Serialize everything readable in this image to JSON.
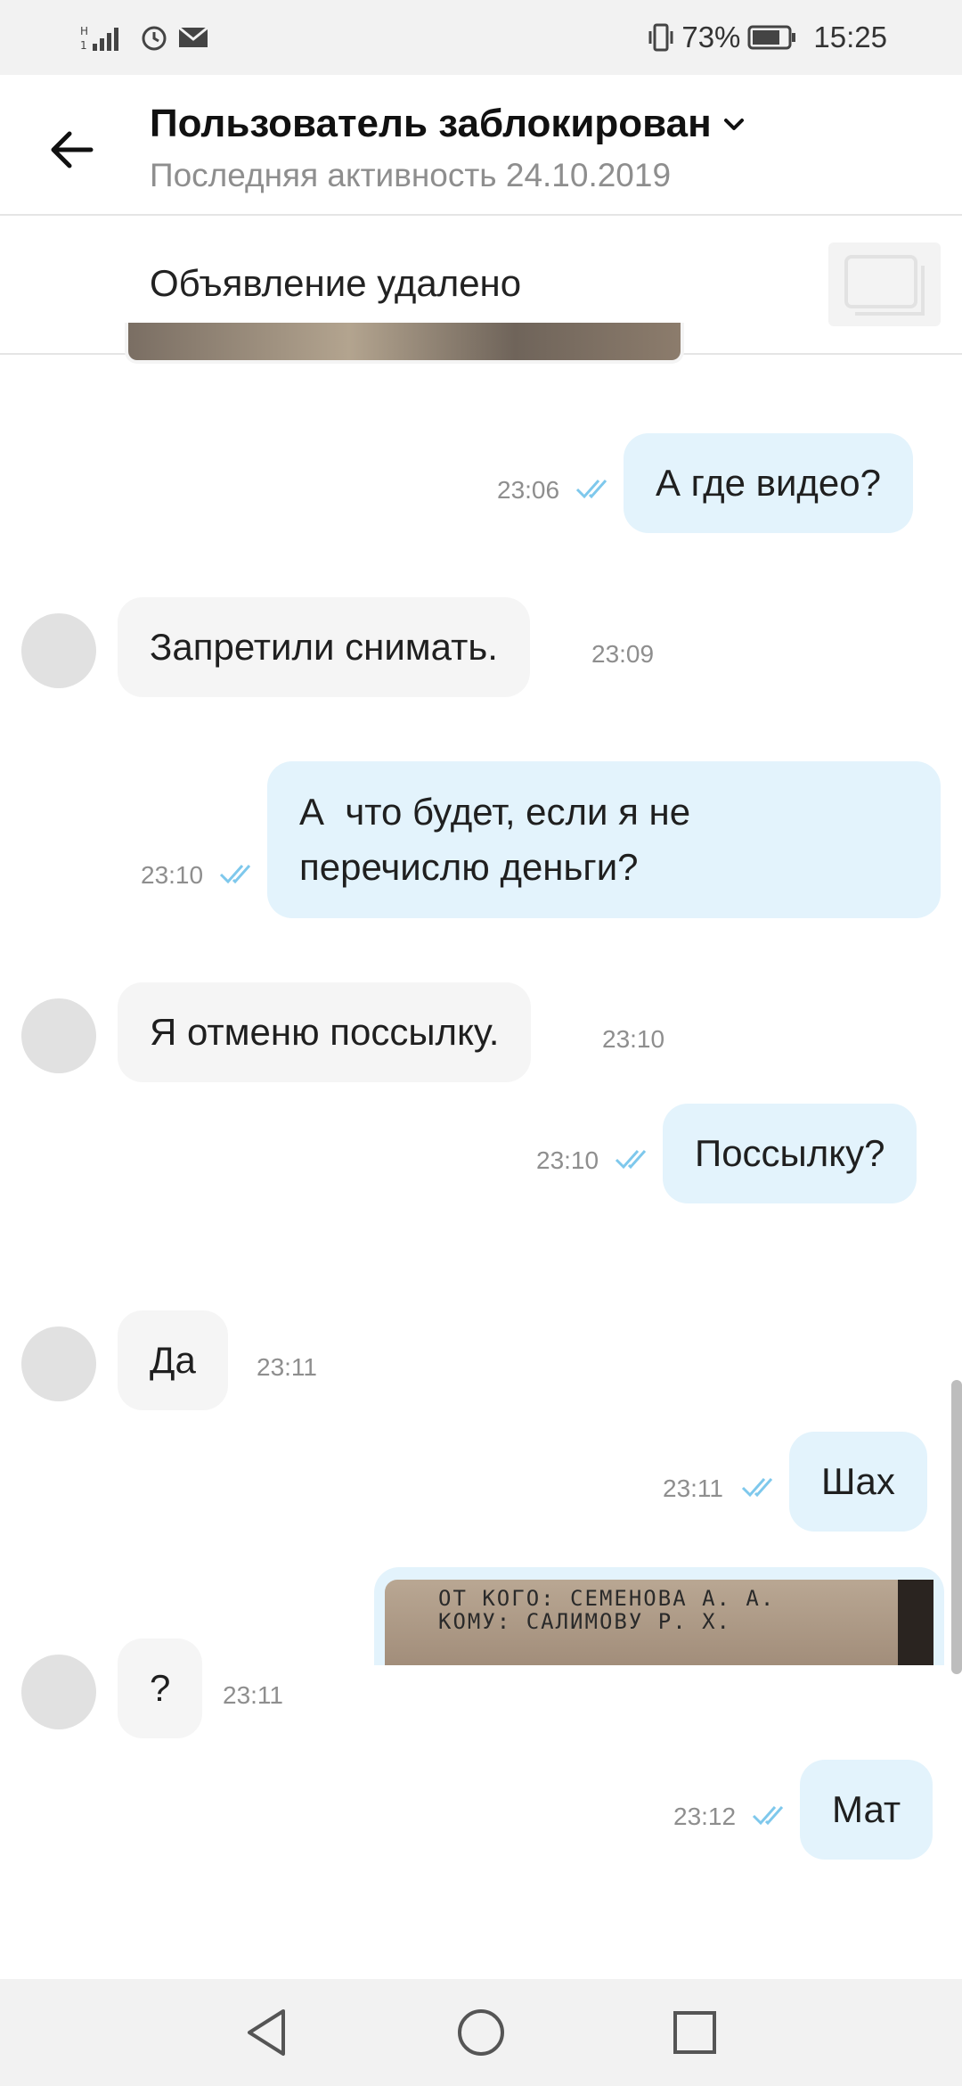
{
  "status_bar": {
    "battery": "73%",
    "time": "15:25",
    "icons": [
      "signal-icon",
      "alarm-icon",
      "mail-icon",
      "vibrate-icon",
      "battery-icon"
    ]
  },
  "header": {
    "title": "Пользователь заблокирован",
    "subtitle": "Последняя активность 24.10.2019"
  },
  "listing": {
    "label": "Объявление удалено"
  },
  "messages": [
    {
      "side": "out",
      "text": "А где видео?",
      "time": "23:06",
      "status": "read"
    },
    {
      "side": "in",
      "text": "Запретили снимать.",
      "time": "23:09"
    },
    {
      "side": "out",
      "text_line1": "А  что будет, если я не",
      "text_line2": "перечислю деньги?",
      "time": "23:10",
      "status": "read"
    },
    {
      "side": "in",
      "text": "Я отменю поссылку.",
      "time": "23:10"
    },
    {
      "side": "out",
      "text": "Поссылку?",
      "time": "23:10",
      "status": "read"
    },
    {
      "side": "in",
      "text": "Да",
      "time": "23:11"
    },
    {
      "side": "out",
      "text": "Шах",
      "time": "23:11",
      "status": "read"
    },
    {
      "side": "in",
      "text": "?",
      "time": "23:11"
    },
    {
      "side": "out",
      "text": "Мат",
      "time": "23:12",
      "status": "read"
    }
  ],
  "photo_text": {
    "line1": "ОТ КОГО: СЕМЕНОВА А. А.",
    "line2": "КОМУ: САЛИМОВУ Р. Х."
  },
  "colors": {
    "outgoing_bubble": "#e3f3fc",
    "incoming_bubble": "#f5f5f5",
    "read_ticks": "#7ec8ec",
    "secondary_text": "#8e8e8e"
  }
}
